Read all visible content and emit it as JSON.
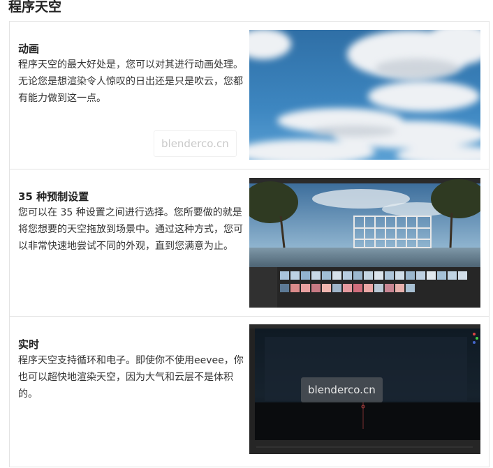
{
  "page": {
    "title": "程序天空"
  },
  "features": [
    {
      "title": "动画",
      "description": "程序天空的最大好处是，您可以对其进行动画处理。无论您是想渲染令人惊叹的日出还是只是吹云，您都有能力做到这一点。",
      "image_icon": "sky-clouds-image",
      "watermark": "blenderco.cn"
    },
    {
      "title": "35 种预制设置",
      "description": "您可以在 35 种设置之间进行选择。您所要做的就是将您想要的天空拖放到场景中。通过这种方式，您可以非常快速地尝试不同的外观，直到您满意为止。",
      "image_icon": "blender-scene-screenshot"
    },
    {
      "title": "实时",
      "description": "程序天空支持循环和电子。即使你不使用eevee，你也可以超快地渲染天空，因为大气和云层不是体积的。",
      "image_icon": "blender-dark-viewport-screenshot",
      "watermark": "blenderco.cn"
    }
  ]
}
